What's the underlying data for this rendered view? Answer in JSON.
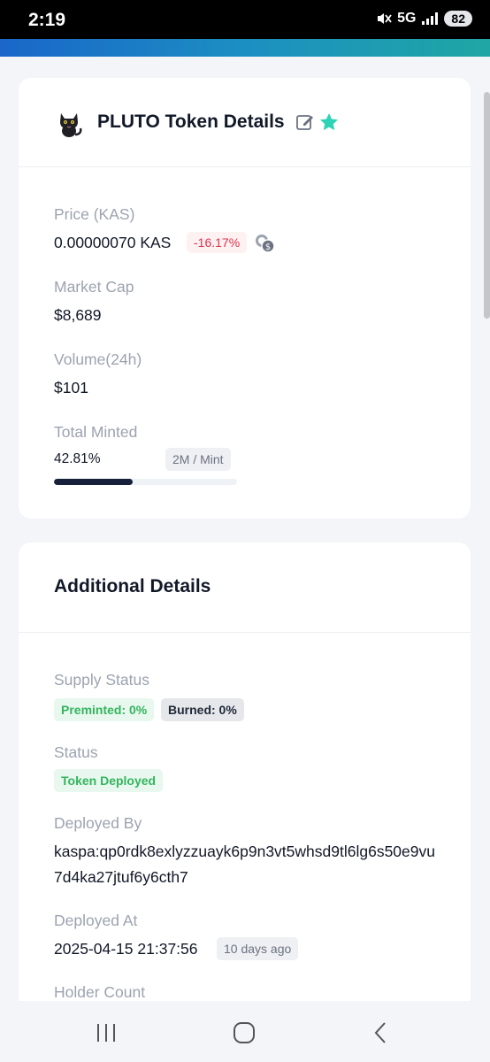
{
  "status_bar": {
    "time": "2:19",
    "network": "5G",
    "battery": "82"
  },
  "token_card": {
    "title": "PLUTO Token Details",
    "price_label": "Price  (KAS)",
    "price_value": "0.00000070 KAS",
    "price_change": "-16.17%",
    "market_cap_label": "Market Cap",
    "market_cap_value": "$8,689",
    "volume_label": "Volume(24h)",
    "volume_value": "$101",
    "minted_label": "Total Minted",
    "minted_percent_text": "42.81%",
    "minted_fraction": 0.4281,
    "mint_limit": "2M / Mint"
  },
  "additional_card": {
    "title": "Additional Details",
    "supply_label": "Supply Status",
    "preminted": "Preminted: 0%",
    "burned": "Burned: 0%",
    "status_label": "Status",
    "status_value": "Token Deployed",
    "deployed_by_label": "Deployed By",
    "deployed_by_value": "kaspa:qp0rdk8exlyzzuayk6p9n3vt5whsd9tl6lg6s50e9vu7d4ka27jtuf6y6cth7",
    "deployed_at_label": "Deployed At",
    "deployed_at_value": "2025-04-15 21:37:56",
    "deployed_relative": "10 days ago",
    "holder_label": "Holder Count"
  },
  "icons": {
    "edit": "pencil-square-icon",
    "favorite": "star-icon",
    "swap": "coin-swap-icon",
    "logo": "cat-logo"
  },
  "colors": {
    "accent_star": "#2ed3b5",
    "negative": "#e0334b",
    "positive_badge": "#34b55e",
    "progress": "#18213b"
  }
}
